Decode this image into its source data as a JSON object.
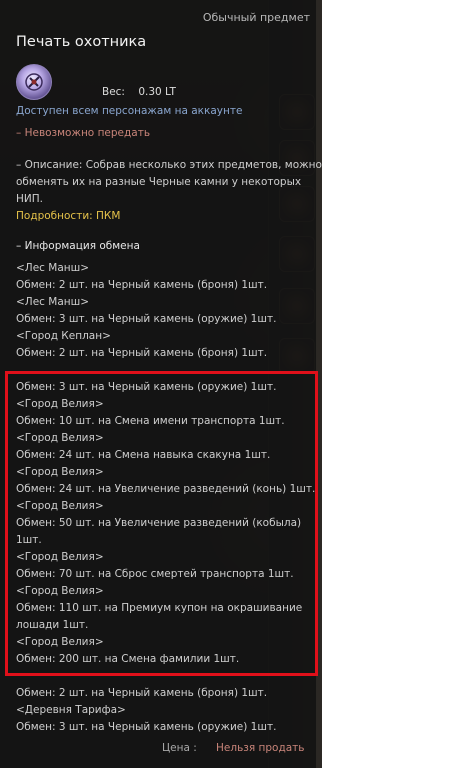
{
  "tooltip": {
    "grade": "Обычный предмет",
    "title": "Печать охотника",
    "weight": "Вес:    0.30 LT",
    "account_note": "Доступен всем персонажам на аккаунте",
    "no_transfer": "– Невозможно передать",
    "description_1": "– Описание: Собрав несколько этих предметов, можно",
    "description_2": "обменять их на разные Черные камни у некоторых",
    "description_3": "НИП.",
    "details": "Подробности: ПКМ",
    "exchange_header": "– Информация обмена",
    "exchange_lines": [
      "<Лес Манш>",
      "Обмен: 2 шт. на Черный камень (броня) 1шт.",
      "<Лес Манш>",
      "Обмен: 3 шт. на Черный камень (оружие) 1шт.",
      "<Город Кеплан>",
      "Обмен: 2 шт. на Черный камень (броня) 1шт.",
      "Обмен: 3 шт. на Черный камень (оружие) 1шт.",
      "<Город Велия>",
      "Обмен: 10 шт. на Смена имени транспорта 1шт.",
      "<Город Велия>",
      "Обмен: 24 шт. на Смена навыка скакуна 1шт.",
      "<Город Велия>",
      "Обмен: 24 шт. на Увеличение разведений (конь) 1шт.",
      "<Город Велия>",
      "Обмен: 50 шт. на Увеличение разведений (кобыла)",
      "1шт.",
      "<Город Велия>",
      "Обмен: 70 шт. на Сброс смертей транспорта 1шт.",
      "<Город Велия>",
      "Обмен: 110 шт. на Премиум купон на окрашивание",
      "лошади 1шт.",
      "<Город Велия>",
      "Обмен: 200 шт. на Смена фамилии 1шт.",
      "Обмен: 2 шт. на Черный камень (броня) 1шт.",
      "<Деревня Тарифа>",
      "Обмен: 3 шт. на Черный камень (оружие) 1шт."
    ],
    "price_label": "Цена :",
    "price_value": "Нельзя продать"
  },
  "colors": {
    "highlight_border": "#e0101a",
    "account_note": "#8aa6cf",
    "warning": "#c9857a",
    "details": "#e5c24a"
  },
  "icons": {
    "item": "seal-icon"
  }
}
